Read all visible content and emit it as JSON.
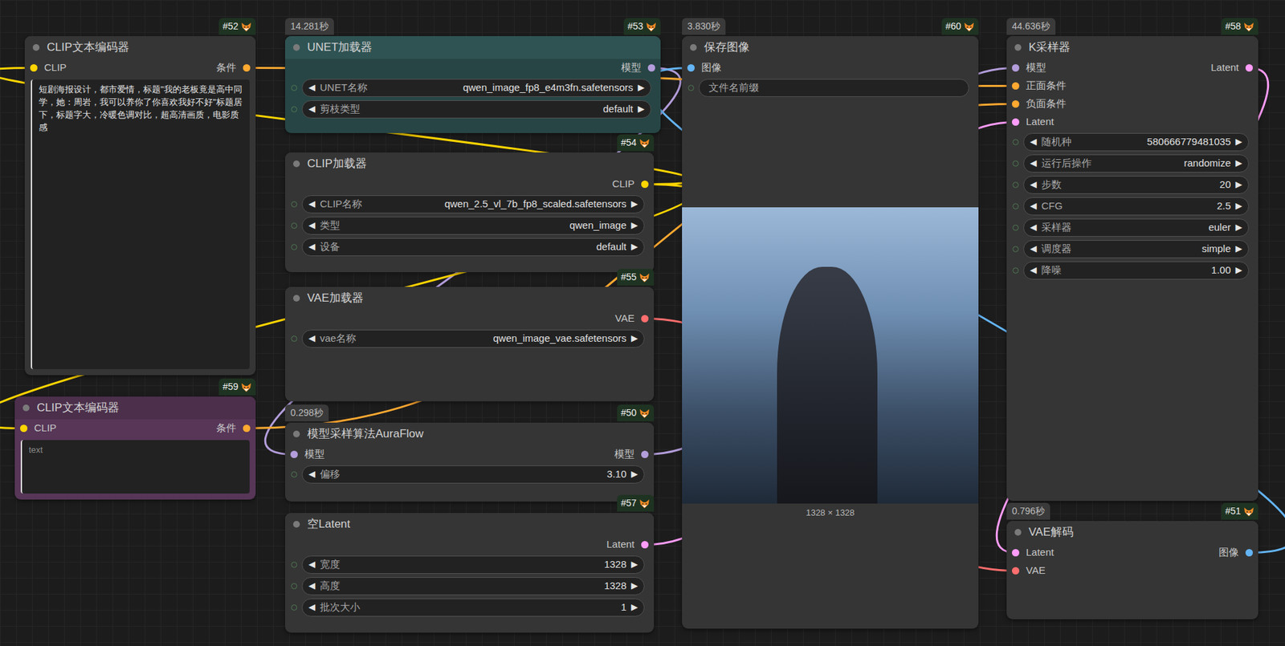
{
  "glyphs": {
    "left": "◀",
    "right": "▶"
  },
  "nodes": [
    {
      "id": "#52",
      "title": "CLIP文本编码器",
      "color": "#353535",
      "title_color": "#353535",
      "inputs": [
        {
          "label": "CLIP",
          "kind": "clip"
        }
      ],
      "outputs": [
        {
          "label": "条件",
          "kind": "cond"
        }
      ],
      "widgets": [
        {
          "kind": "textarea",
          "value": "短剧海报设计，都市爱情，标题\"我的老板竟是高中同学，她：周岩，我可以养你了你喜欢我好不好\"标题居下，标题字大，冷暖色调对比，超高清画质，电影质感"
        }
      ]
    },
    {
      "id": "#53",
      "title": "UNET加载器",
      "time": "14.281秒",
      "color": "#274545",
      "title_color": "#2f5353",
      "inputs": [],
      "outputs": [
        {
          "label": "模型",
          "kind": "model"
        }
      ],
      "widgets": [
        {
          "kind": "value",
          "label": "UNET名称",
          "value": "qwen_image_fp8_e4m3fn.safetensors"
        },
        {
          "kind": "value",
          "label": "剪枝类型",
          "value": "default"
        }
      ]
    },
    {
      "id": "#54",
      "title": "CLIP加载器",
      "color": "#353535",
      "title_color": "#353535",
      "inputs": [],
      "outputs": [
        {
          "label": "CLIP",
          "kind": "clip"
        }
      ],
      "widgets": [
        {
          "kind": "value",
          "label": "CLIP名称",
          "value": "qwen_2.5_vl_7b_fp8_scaled.safetensors"
        },
        {
          "kind": "value",
          "label": "类型",
          "value": "qwen_image"
        },
        {
          "kind": "value",
          "label": "设备",
          "value": "default"
        }
      ]
    },
    {
      "id": "#55",
      "title": "VAE加载器",
      "color": "#353535",
      "title_color": "#353535",
      "inputs": [],
      "outputs": [
        {
          "label": "VAE",
          "kind": "vae"
        }
      ],
      "widgets": [
        {
          "kind": "value",
          "label": "vae名称",
          "value": "qwen_image_vae.safetensors"
        }
      ]
    },
    {
      "id": "#50",
      "title": "模型采样算法AuraFlow",
      "time": "0.298秒",
      "color": "#353535",
      "title_color": "#353535",
      "inputs": [
        {
          "label": "模型",
          "kind": "model"
        }
      ],
      "outputs": [
        {
          "label": "模型",
          "kind": "model"
        }
      ],
      "widgets": [
        {
          "kind": "value",
          "label": "偏移",
          "value": "3.10"
        }
      ]
    },
    {
      "id": "#57",
      "title": "空Latent",
      "color": "#353535",
      "title_color": "#353535",
      "inputs": [],
      "outputs": [
        {
          "label": "Latent",
          "kind": "latent"
        }
      ],
      "widgets": [
        {
          "kind": "value",
          "label": "宽度",
          "value": "1328"
        },
        {
          "kind": "value",
          "label": "高度",
          "value": "1328"
        },
        {
          "kind": "value",
          "label": "批次大小",
          "value": "1"
        }
      ]
    },
    {
      "id": "#59",
      "title": "CLIP文本编码器",
      "color": "#573657",
      "title_color": "#4b2f4b",
      "inputs": [
        {
          "label": "CLIP",
          "kind": "clip"
        }
      ],
      "outputs": [
        {
          "label": "条件",
          "kind": "cond"
        }
      ],
      "widgets": [
        {
          "kind": "textarea",
          "placeholder": "text"
        }
      ]
    },
    {
      "id": "#60",
      "title": "保存图像",
      "time": "3.830秒",
      "color": "#353535",
      "title_color": "#353535",
      "inputs": [
        {
          "label": "图像",
          "kind": "image"
        }
      ],
      "outputs": [],
      "widgets": [
        {
          "kind": "text",
          "label": "文件名前缀"
        },
        {
          "kind": "image",
          "caption": "1328 × 1328"
        }
      ]
    },
    {
      "id": "#58",
      "title": "K采样器",
      "time": "44.636秒",
      "color": "#353535",
      "title_color": "#353535",
      "inputs": [
        {
          "label": "模型",
          "kind": "model"
        },
        {
          "label": "正面条件",
          "kind": "cond"
        },
        {
          "label": "负面条件",
          "kind": "cond"
        },
        {
          "label": "Latent",
          "kind": "latent"
        }
      ],
      "outputs": [
        {
          "label": "Latent",
          "kind": "latent"
        }
      ],
      "widgets": [
        {
          "kind": "value",
          "label": "随机种",
          "value": "580666779481035"
        },
        {
          "kind": "value",
          "label": "运行后操作",
          "value": "randomize"
        },
        {
          "kind": "value",
          "label": "步数",
          "value": "20"
        },
        {
          "kind": "value",
          "label": "CFG",
          "value": "2.5"
        },
        {
          "kind": "value",
          "label": "采样器",
          "value": "euler"
        },
        {
          "kind": "value",
          "label": "调度器",
          "value": "simple"
        },
        {
          "kind": "value",
          "label": "降噪",
          "value": "1.00"
        }
      ]
    },
    {
      "id": "#51",
      "title": "VAE解码",
      "time": "0.796秒",
      "color": "#353535",
      "title_color": "#353535",
      "inputs": [
        {
          "label": "Latent",
          "kind": "latent"
        },
        {
          "label": "VAE",
          "kind": "vae"
        }
      ],
      "outputs": [
        {
          "label": "图像",
          "kind": "image"
        }
      ],
      "widgets": []
    }
  ],
  "links": [
    {
      "from": "#53",
      "out": 0,
      "to": "#50",
      "in": 0,
      "kind": "model"
    },
    {
      "from": "#54",
      "out": 0,
      "to": "#52",
      "in": 0,
      "kind": "clip"
    },
    {
      "from": "#54",
      "out": 0,
      "to": "#59",
      "in": 0,
      "kind": "clip"
    },
    {
      "from": "#50",
      "out": 0,
      "to": "#58",
      "in": 0,
      "kind": "model"
    },
    {
      "from": "#52",
      "out": 0,
      "to": "#58",
      "in": 1,
      "kind": "cond"
    },
    {
      "from": "#59",
      "out": 0,
      "to": "#58",
      "in": 2,
      "kind": "cond"
    },
    {
      "from": "#57",
      "out": 0,
      "to": "#58",
      "in": 3,
      "kind": "latent"
    },
    {
      "from": "#58",
      "out": 0,
      "to": "#51",
      "in": 0,
      "kind": "latent"
    },
    {
      "from": "#55",
      "out": 0,
      "to": "#51",
      "in": 1,
      "kind": "vae"
    },
    {
      "from": "#51",
      "out": 0,
      "to": "#60",
      "in": 0,
      "kind": "image"
    }
  ]
}
